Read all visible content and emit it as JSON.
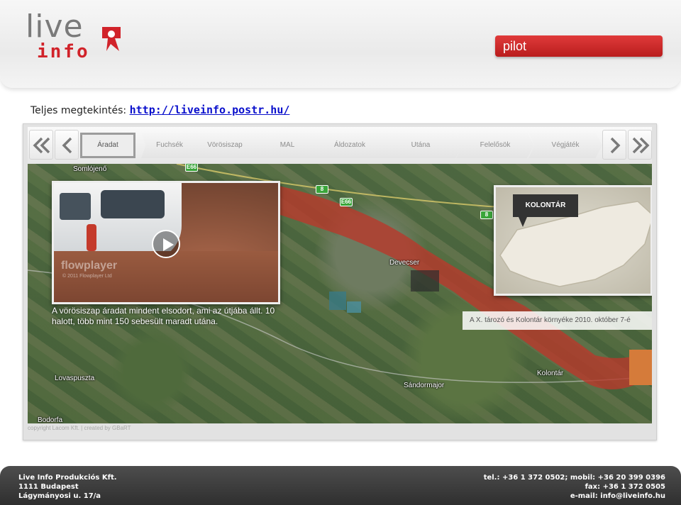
{
  "header": {
    "logo_line1": "live",
    "logo_line2": "info",
    "pilot_label": "pilot"
  },
  "view_line": {
    "label": "Teljes megtekintés:",
    "link_text": "http://liveinfo.postr.hu/"
  },
  "player": {
    "tabs": [
      "Áradat",
      "Fuchsék",
      "Vörösiszap",
      "MAL",
      "Áldozatok",
      "Utána",
      "Felelősök",
      "Végjáték"
    ],
    "active_tab": "Áradat",
    "video": {
      "brand": "flowplayer",
      "brand_sub": "© 2011 Flowplayer Ltd"
    },
    "caption": "A vörösiszap áradat mindent elsodort, ami az útjába állt. 10 halott, több mint 150 sebesült maradt utána.",
    "inset_label": "KOLONTÁR",
    "map_caption": "A X. tározó és Kolontár környéke 2010. október 7-é",
    "map_labels": {
      "somlojeno": "Somlójenő",
      "devecser": "Devecser",
      "lovaspuszta": "Lovaspuszta",
      "sandormajor": "Sándormajor",
      "kolontar": "Kolontár",
      "bodorfa": "Bodorfa"
    },
    "road_labels": {
      "e66_a": "E66",
      "e66_b": "E66",
      "r8_a": "8",
      "r8_b": "8"
    },
    "footer_credit": "copyright Lacom Kft. | created by GBaRT"
  },
  "footer": {
    "company": "Live Info Produkciós Kft.",
    "city": "1111 Budapest",
    "street": "Lágymányosi u. 17/a",
    "phones": "tel.: +36 1 372 0502; mobil: +36 20 399 0396",
    "fax": "fax: +36 1 372 0505",
    "email": "e-mail: info@liveinfo.hu"
  },
  "colors": {
    "brand_red": "#d1232a",
    "link": "#0a10cc",
    "footer_bg": "#3a3a3a",
    "sludge": "#b83a2c"
  }
}
